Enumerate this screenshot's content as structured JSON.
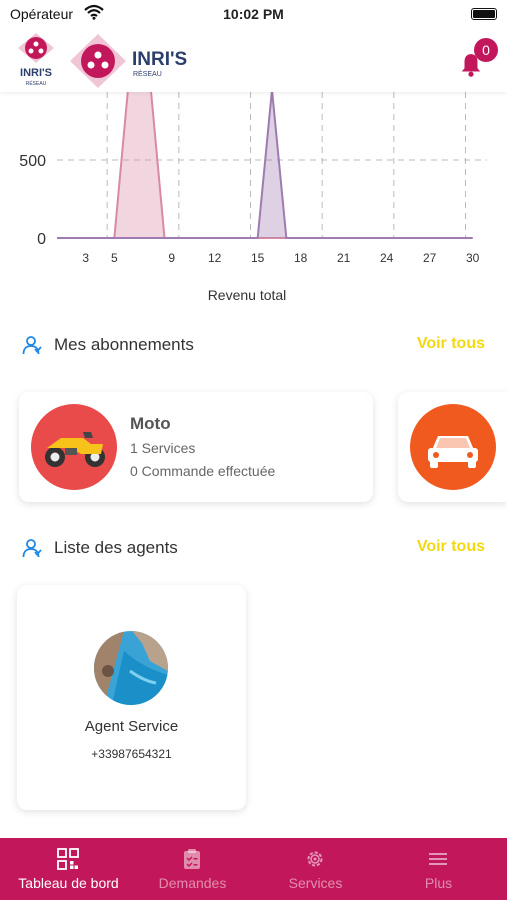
{
  "status_bar": {
    "carrier": "Opérateur",
    "time": "10:02 PM"
  },
  "header": {
    "logo_small_text": "INRI'S",
    "logo_small_sub": "RÉSEAU",
    "logo_text": "INRI'S",
    "logo_sub": "RÉSEAU",
    "notification_count": "0",
    "icons": {
      "bell": "bell-icon"
    }
  },
  "chart_data": {
    "type": "area",
    "xlabel": "Revenu total",
    "x_ticks": [
      "3",
      "5",
      "9",
      "12",
      "15",
      "18",
      "21",
      "24",
      "27",
      "30"
    ],
    "y_ticks": [
      "0",
      "500"
    ],
    "ylim": [
      0,
      1000
    ],
    "grid": true,
    "series": [
      {
        "x": [
          1,
          5,
          6,
          7.5,
          8.5,
          30
        ],
        "values": [
          0,
          0,
          1000,
          1000,
          0,
          0
        ],
        "color": "#d98aa3"
      },
      {
        "x": [
          1,
          15,
          16,
          17,
          30
        ],
        "values": [
          0,
          0,
          950,
          0,
          0
        ],
        "color": "#9e7bb0"
      }
    ]
  },
  "subscriptions": {
    "title": "Mes abonnements",
    "see_all": "Voir tous",
    "items": [
      {
        "name": "Moto",
        "services": "1 Services",
        "orders": "0 Commande effectuée",
        "icon": "motorcycle-icon",
        "color": "#e94a4a"
      },
      {
        "name": "",
        "services": "",
        "orders": "",
        "icon": "car-icon",
        "color": "#f15a1f"
      }
    ]
  },
  "agents": {
    "title": "Liste des agents",
    "see_all": "Voir tous",
    "items": [
      {
        "name": "Agent Service",
        "phone": "+33987654321"
      }
    ]
  },
  "tabbar": {
    "items": [
      {
        "label": "Tableau de bord",
        "icon": "dashboard-icon",
        "active": true
      },
      {
        "label": "Demandes",
        "icon": "clipboard-icon",
        "active": false
      },
      {
        "label": "Services",
        "icon": "gear-icon",
        "active": false
      },
      {
        "label": "Plus",
        "icon": "menu-icon",
        "active": false
      }
    ]
  },
  "colors": {
    "accent": "#c2185b",
    "link": "#f5d90f",
    "section_icon": "#1e88e5"
  }
}
